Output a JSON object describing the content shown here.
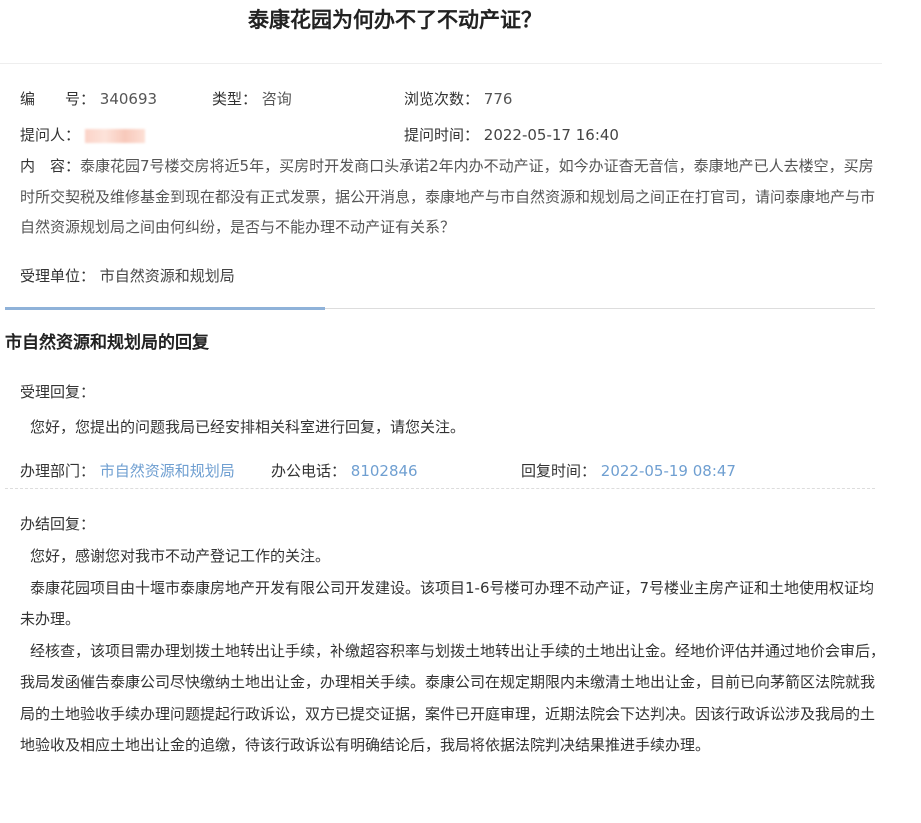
{
  "page": {
    "title": "泰康花园为何办不了不动产证？"
  },
  "question": {
    "number_label": "编　　号：",
    "number_value": "340693",
    "type_label": "类型：",
    "type_value": "咨询",
    "views_label": "浏览次数：",
    "views_value": "776",
    "asker_label": "提问人：",
    "asktime_label": "提问时间：",
    "asktime_value": "2022-05-17 16:40",
    "content_label": "内　容：",
    "content_value": "泰康花园7号楼交房将近5年，买房时开发商口头承诺2年内办不动产证，如今办证杳无音信，泰康地产已人去楼空，买房时所交契税及维修基金到现在都没有正式发票，据公开消息，泰康地产与市自然资源和规划局之间正在打官司，请问泰康地产与市自然资源规划局之间由何纠纷，是否与不能办理不动产证有关系？",
    "dept_label": "受理单位：",
    "dept_value": "市自然资源和规划局"
  },
  "reply": {
    "heading": "市自然资源和规划局的回复",
    "accept_label": "受理回复：",
    "accept_text": "您好，您提出的问题我局已经安排相关科室进行回复，请您关注。",
    "office_label": "办理部门：",
    "office_value": "市自然资源和规划局",
    "phone_label": "办公电话：",
    "phone_value": "8102846",
    "time_label": "回复时间：",
    "time_value": "2022-05-19 08:47",
    "final_label": "办结回复：",
    "paragraphs": [
      "您好，感谢您对我市不动产登记工作的关注。",
      "泰康花园项目由十堰市泰康房地产开发有限公司开发建设。该项目1-6号楼可办理不动产证，7号楼业主房产证和土地使用权证均未办理。",
      "经核查，该项目需办理划拨土地转出让手续，补缴超容积率与划拨土地转出让手续的土地出让金。经地价评估并通过地价会审后，我局发函催告泰康公司尽快缴纳土地出让金，办理相关手续。泰康公司在规定期限内未缴清土地出让金，目前已向茅箭区法院就我局的土地验收手续办理问题提起行政诉讼，双方已提交证据，案件已开庭审理，近期法院会下达判决。因该行政诉讼涉及我局的土地验收及相应土地出让金的追缴，待该行政诉讼有明确结论后，我局将依据法院判决结果推进手续办理。"
    ]
  }
}
